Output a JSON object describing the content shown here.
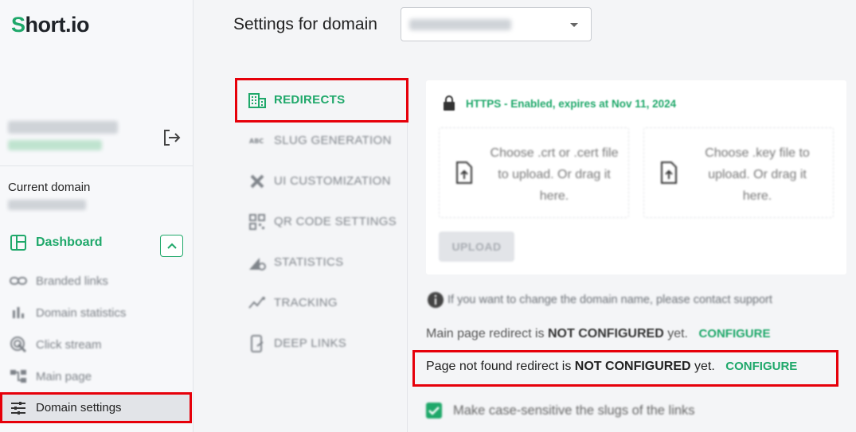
{
  "app": {
    "logo_prefix": "S",
    "logo_rest": "hort.io"
  },
  "sidebar": {
    "current_domain_label": "Current domain",
    "dashboard_label": "Dashboard",
    "items": [
      {
        "label": "Branded links",
        "icon": "link-icon"
      },
      {
        "label": "Domain statistics",
        "icon": "bar-chart-icon"
      },
      {
        "label": "Click stream",
        "icon": "click-stream-icon"
      },
      {
        "label": "Main page",
        "icon": "main-page-icon"
      },
      {
        "label": "Domain settings",
        "icon": "sliders-icon",
        "active": true
      }
    ]
  },
  "header": {
    "title": "Settings for domain"
  },
  "settings_tabs": [
    {
      "label": "REDIRECTS",
      "icon": "building-icon",
      "active": true
    },
    {
      "label": "SLUG GENERATION",
      "icon": "abc-icon"
    },
    {
      "label": "UI CUSTOMIZATION",
      "icon": "tools-icon"
    },
    {
      "label": "QR CODE SETTINGS",
      "icon": "qr-code-icon"
    },
    {
      "label": "STATISTICS",
      "icon": "chart-gear-icon"
    },
    {
      "label": "TRACKING",
      "icon": "tracking-icon"
    },
    {
      "label": "DEEP LINKS",
      "icon": "mobile-link-icon"
    }
  ],
  "ssl": {
    "status": "HTTPS - Enabled, expires at Nov 11, 2024",
    "cert_drop": "Choose .crt or .cert file to upload. Or drag it here.",
    "key_drop": "Choose .key file to upload. Or drag it here.",
    "upload_label": "UPLOAD"
  },
  "info_text": "If you want to change the domain name, please contact support",
  "main_redirect": {
    "prefix": "Main page redirect is",
    "status": "NOT CONFIGURED",
    "suffix": "yet.",
    "action": "CONFIGURE"
  },
  "not_found_redirect": {
    "prefix": "Page not found redirect is",
    "status": "NOT CONFIGURED",
    "suffix": "yet.",
    "action": "CONFIGURE"
  },
  "case_sensitive": {
    "label": "Make case-sensitive the slugs of the links",
    "checked": true
  },
  "colors": {
    "accent": "#1fa86a",
    "highlight": "#e6000a"
  }
}
